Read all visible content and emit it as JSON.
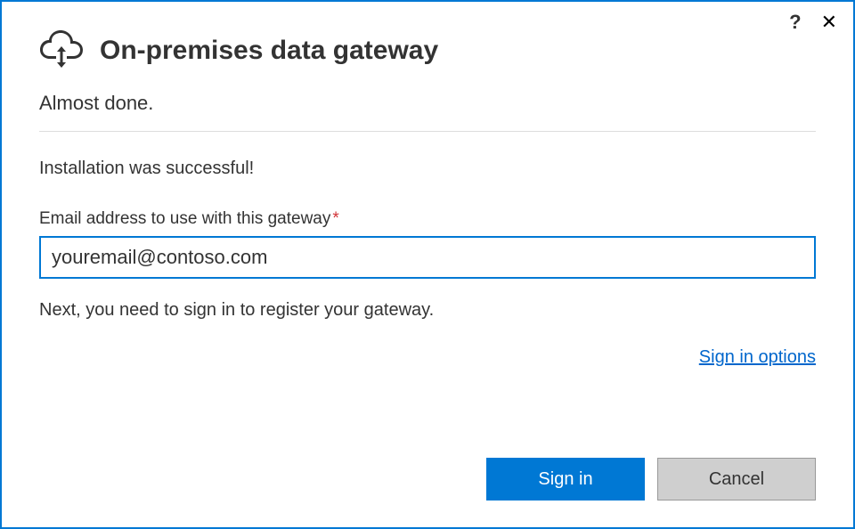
{
  "titlebar": {
    "help_icon": "?",
    "close_icon": "✕"
  },
  "header": {
    "title": "On-premises data gateway"
  },
  "body": {
    "subtitle": "Almost done.",
    "status": "Installation was successful!",
    "email_label": "Email address to use with this gateway",
    "required_mark": "*",
    "email_value": "youremail@contoso.com",
    "next_text": "Next, you need to sign in to register your gateway.",
    "options_link": "Sign in options"
  },
  "footer": {
    "primary_label": "Sign in",
    "secondary_label": "Cancel"
  }
}
